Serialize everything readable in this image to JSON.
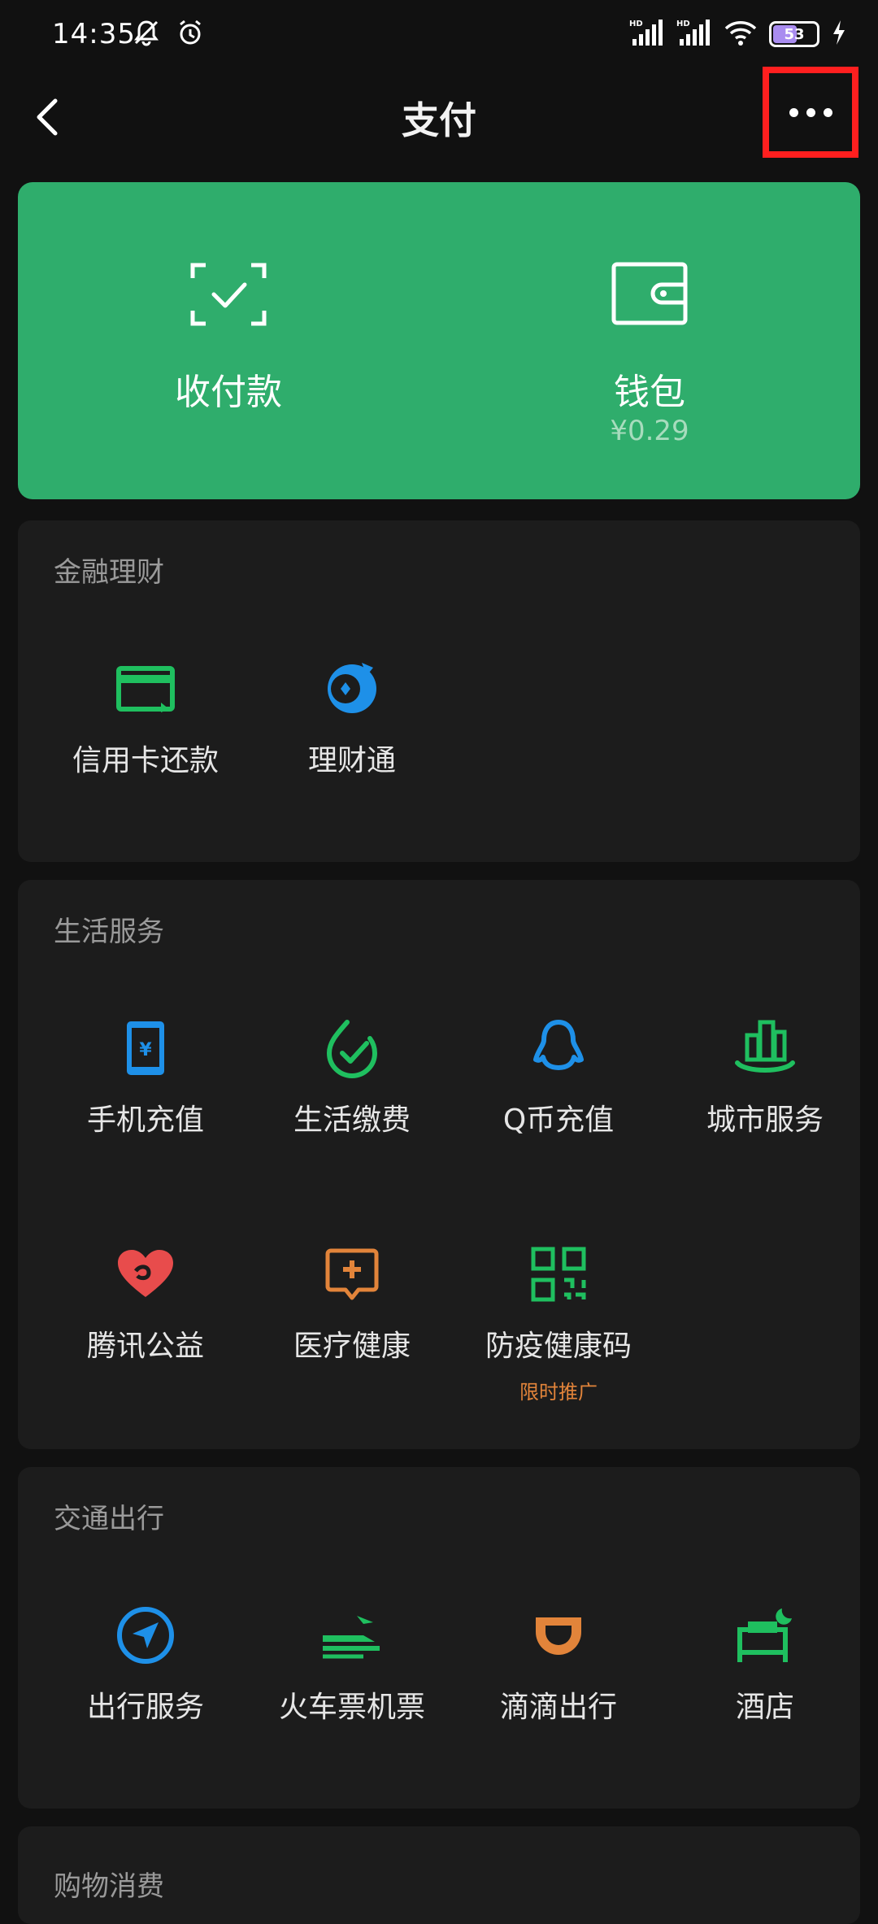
{
  "status_bar": {
    "time": "14:35",
    "battery_level": "53",
    "icons": [
      "mute-bell-icon",
      "alarm-icon",
      "signal-hd-icon",
      "signal-hd-icon",
      "wifi-icon",
      "battery-icon",
      "charging-icon"
    ]
  },
  "nav": {
    "title": "支付",
    "back_icon": "chevron-left-icon",
    "more_icon": "more-dots-icon"
  },
  "hero": {
    "pay_label": "收付款",
    "wallet_label": "钱包",
    "wallet_balance": "¥0.29",
    "background": "#2fad6c"
  },
  "finance": {
    "title": "金融理财",
    "items": [
      {
        "label": "信用卡还款",
        "icon": "credit-card-icon",
        "color": "#1fbf5f"
      },
      {
        "label": "理财通",
        "icon": "licaitong-icon",
        "color": "#1e90e8"
      }
    ]
  },
  "life": {
    "title": "生活服务",
    "items": [
      {
        "label": "手机充值",
        "icon": "phone-recharge-icon",
        "color": "#1e90e8"
      },
      {
        "label": "生活缴费",
        "icon": "bill-payment-icon",
        "color": "#1fbf5f"
      },
      {
        "label": "Q币充值",
        "icon": "qq-penguin-icon",
        "color": "#1e90e8"
      },
      {
        "label": "城市服务",
        "icon": "city-service-icon",
        "color": "#1fbf5f"
      },
      {
        "label": "腾讯公益",
        "icon": "charity-heart-icon",
        "color": "#e84c4c"
      },
      {
        "label": "医疗健康",
        "icon": "medical-icon",
        "color": "#e2843a"
      },
      {
        "label": "防疫健康码",
        "icon": "qr-code-icon",
        "color": "#1fbf5f",
        "sub": "限时推广"
      }
    ]
  },
  "transport": {
    "title": "交通出行",
    "items": [
      {
        "label": "出行服务",
        "icon": "navigation-icon",
        "color": "#1e90e8"
      },
      {
        "label": "火车票机票",
        "icon": "train-plane-icon",
        "color": "#1fbf5f"
      },
      {
        "label": "滴滴出行",
        "icon": "didi-icon",
        "color": "#e2843a"
      },
      {
        "label": "酒店",
        "icon": "hotel-bed-icon",
        "color": "#1fbf5f"
      }
    ]
  },
  "shopping": {
    "title": "购物消费"
  }
}
